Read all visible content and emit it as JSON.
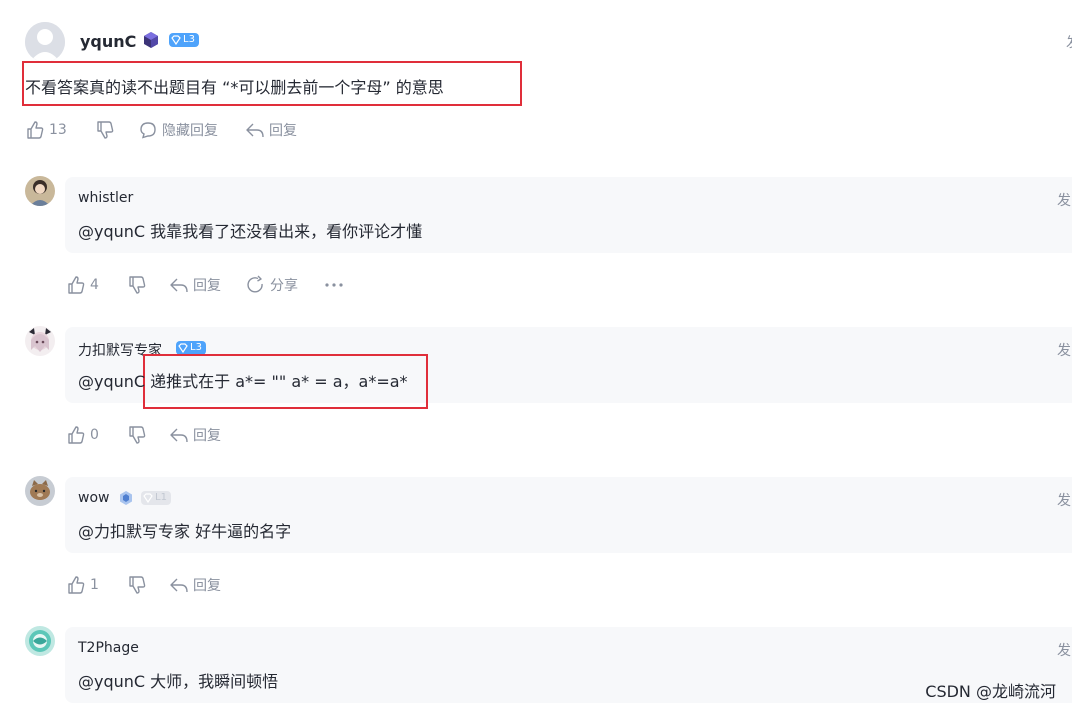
{
  "main_comment": {
    "username": "yqunC",
    "level": "L3",
    "date_fragment": "发",
    "text": "不看答案真的读不出题目有 “*可以删去前一个字母” 的意思",
    "actions": {
      "like_count": "13",
      "hide_replies_label": "隐藏回复",
      "reply_label": "回复"
    }
  },
  "replies": [
    {
      "username": "whistler",
      "date_fragment": "发",
      "text": "@yqunC 我靠我看了还没看出来，看你评论才懂",
      "like_count": "4",
      "reply_label": "回复",
      "share_label": "分享"
    },
    {
      "username": "力扣默写专家",
      "level": "L3",
      "date_fragment": "发",
      "text": "@yqunC 递推式在于 a*= \"\" a* = a，a*=a*",
      "like_count": "0",
      "reply_label": "回复"
    },
    {
      "username": "wow",
      "level": "L1",
      "date_fragment": "发",
      "text": "@力扣默写专家 好牛逼的名字",
      "like_count": "1",
      "reply_label": "回复"
    },
    {
      "username": "T2Phage",
      "date_fragment": "发",
      "text": "@yqunC 大师，我瞬间顿悟"
    }
  ],
  "watermark": "CSDN @龙崎流河",
  "colors": {
    "highlight_box": "#e02e3a",
    "level_badge": "#4ea3fb",
    "bubble_bg": "#f7f8fa",
    "muted_text": "#8a919f"
  }
}
